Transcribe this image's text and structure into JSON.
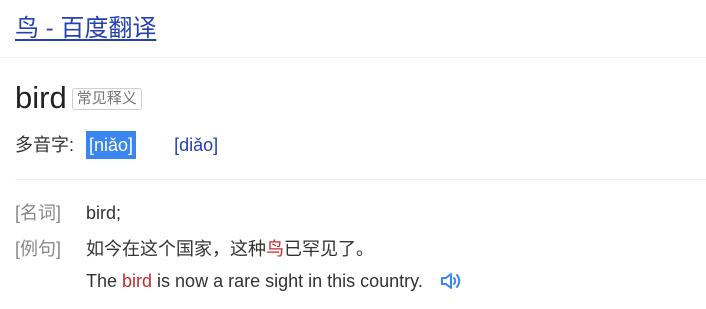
{
  "title": "鸟 - 百度翻译",
  "word": {
    "headword": "bird",
    "badge": "常见释义"
  },
  "polyphone": {
    "label": "多音字:",
    "readings": [
      "[niǎo]",
      "[diǎo]"
    ],
    "selected_index": 0
  },
  "definition": {
    "pos_label": "[名词]",
    "meaning": "bird;"
  },
  "example": {
    "label": "[例句]",
    "zh_before": "如今在这个国家，这种",
    "zh_highlight": "鸟",
    "zh_after": "已罕见了。",
    "en_before": "The ",
    "en_highlight": "bird",
    "en_after": " is now a rare sight in this country.",
    "speaker_icon": "speaker-icon"
  },
  "colors": {
    "link": "#2440b3",
    "highlight": "#c52b2b",
    "selected_pinyin_bg": "#3a86f0"
  }
}
